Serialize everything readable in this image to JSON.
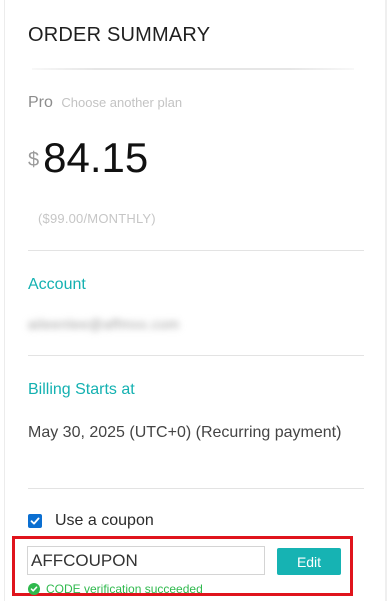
{
  "summary": {
    "title": "ORDER SUMMARY",
    "plan_name": "Pro",
    "change_plan_link": "Choose another plan",
    "currency_symbol": "$",
    "amount": "84.15",
    "original_price_note": "($99.00/MONTHLY)"
  },
  "account": {
    "label": "Account",
    "value": "aileenlee@affmxx.com"
  },
  "billing": {
    "label": "Billing Starts at",
    "value": "May 30, 2025 (UTC+0) (Recurring payment)"
  },
  "coupon": {
    "checkbox_label": "Use a coupon",
    "checked": true,
    "code_value": "AFFCOUPON",
    "edit_label": "Edit",
    "status_text": "CODE verification succeeded",
    "accent_color": "#16b3b3",
    "success_color": "#2fb94d",
    "highlight_color": "#e0141c"
  },
  "icons": {
    "checkbox_icon": "checkmark-icon",
    "status_icon": "check-circle-icon"
  }
}
